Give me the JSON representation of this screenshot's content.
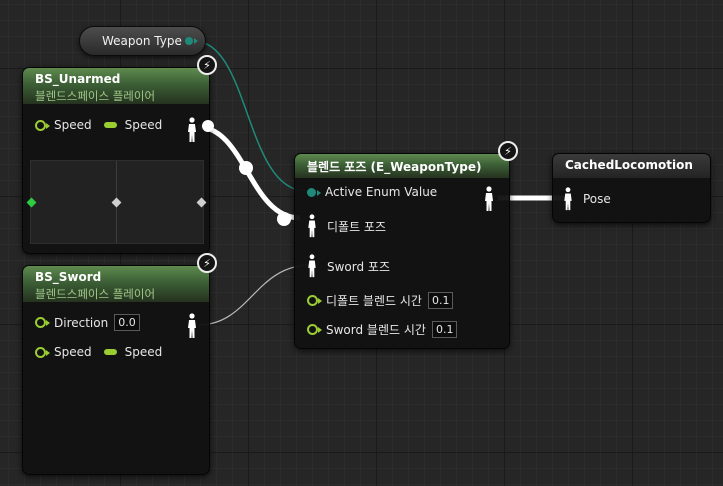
{
  "colors": {
    "exec_white": "#ffffff",
    "enum_wire": "#1f8a7a",
    "float_pin": "#9acd32",
    "header_green": "#4a7440"
  },
  "weapon_type": {
    "label": "Weapon Type"
  },
  "bs_unarmed": {
    "title": "BS_Unarmed",
    "subtitle": "블렌드스페이스 플레이어",
    "pin_speed_label": "Speed",
    "input_speed_label": "Speed",
    "icon": "lightning-icon"
  },
  "bs_sword": {
    "title": "BS_Sword",
    "subtitle": "블렌드스페이스 플레이어",
    "direction_label": "Direction",
    "direction_value": "0.0",
    "pin_speed_label": "Speed",
    "input_speed_label": "Speed",
    "icon": "lightning-icon"
  },
  "blend_node": {
    "title": "블렌드 포즈 (E_WeaponType)",
    "active_enum_label": "Active Enum Value",
    "default_pose_label": "디폴트 포즈",
    "sword_pose_label": "Sword 포즈",
    "default_blend_time_label": "디폴트 블렌드 시간",
    "default_blend_time_value": "0.1",
    "sword_blend_time_label": "Sword 블렌드 시간",
    "sword_blend_time_value": "0.1",
    "icon": "lightning-icon"
  },
  "cached_locomotion": {
    "title": "CachedLocomotion",
    "pose_label": "Pose"
  }
}
